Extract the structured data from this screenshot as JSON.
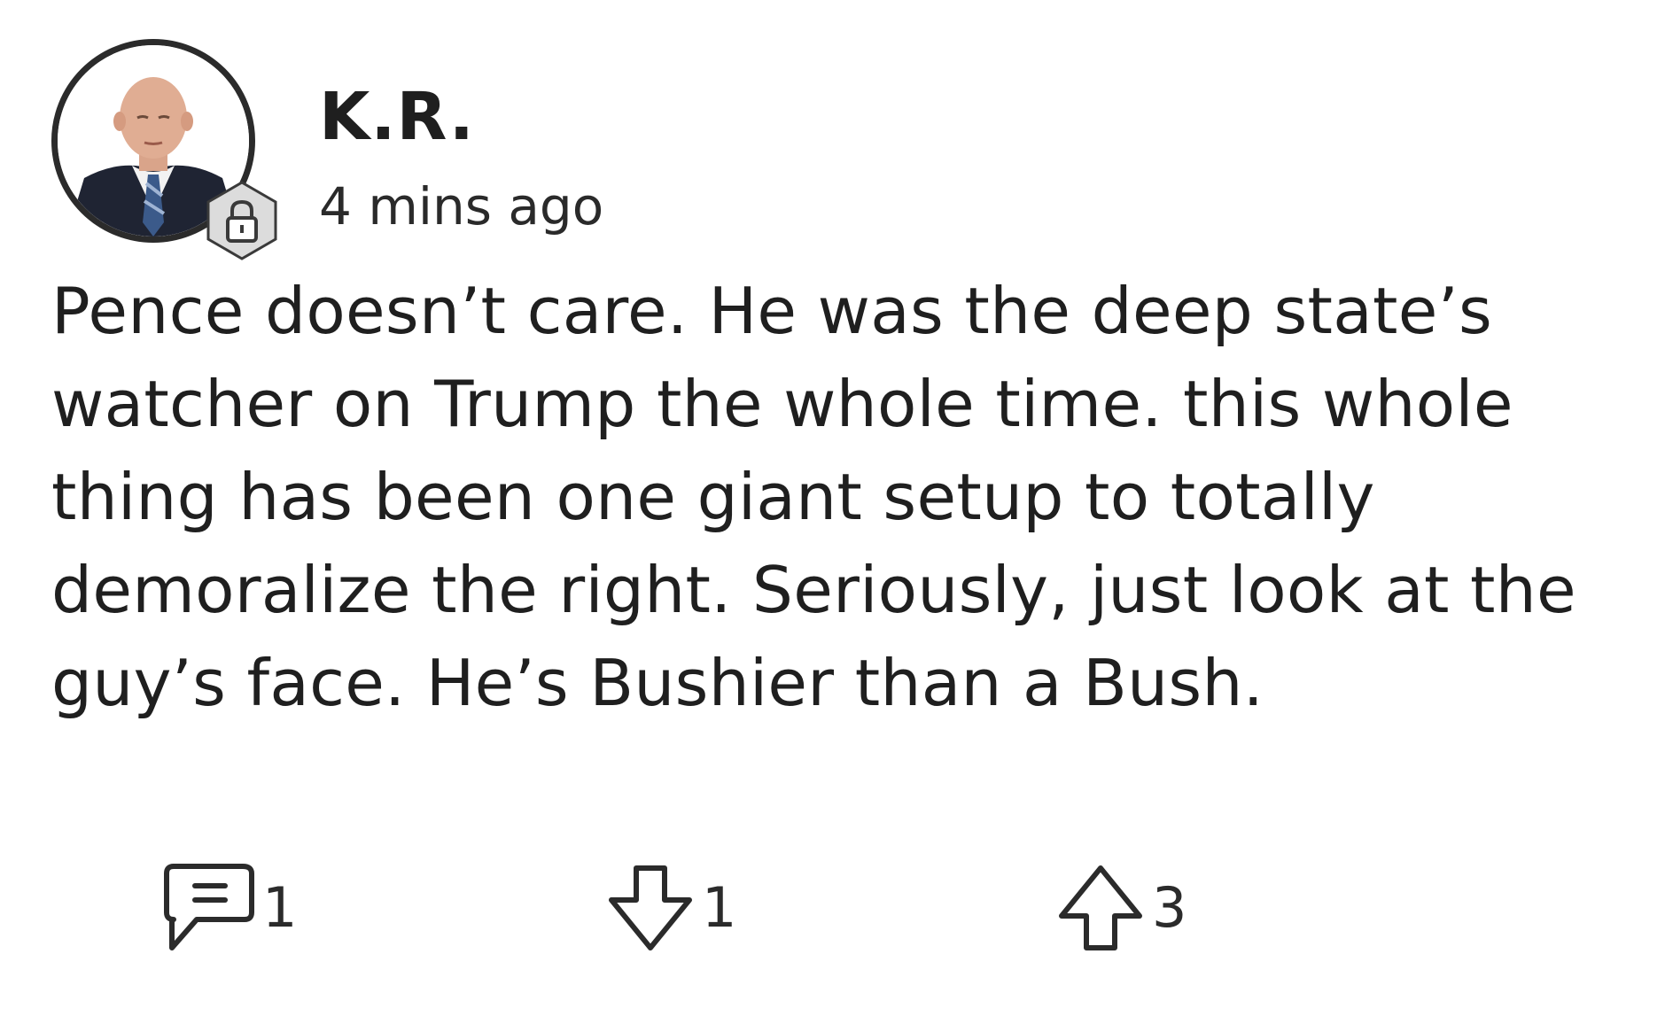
{
  "post": {
    "author": "K.R.",
    "timestamp": "4 mins ago",
    "body": "Pence doesn’t care. He was the deep state’s watcher on Trump the whole time. this whole thing has been one giant setup to totally demoralize the right. Seriously, just look at the guy’s face. He’s Bushier than a Bush.",
    "avatar_icon": "avatar-photo",
    "badge_icon": "lock-icon"
  },
  "actions": {
    "reply_icon": "comment-icon",
    "reply_count": "1",
    "downvote_icon": "arrow-down-icon",
    "downvote_count": "1",
    "upvote_icon": "arrow-up-icon",
    "upvote_count": "3"
  },
  "colors": {
    "text": "#1f1f1f",
    "icon_stroke": "#2b2b2b",
    "badge_fill": "#dcdcdc",
    "background": "#ffffff"
  }
}
